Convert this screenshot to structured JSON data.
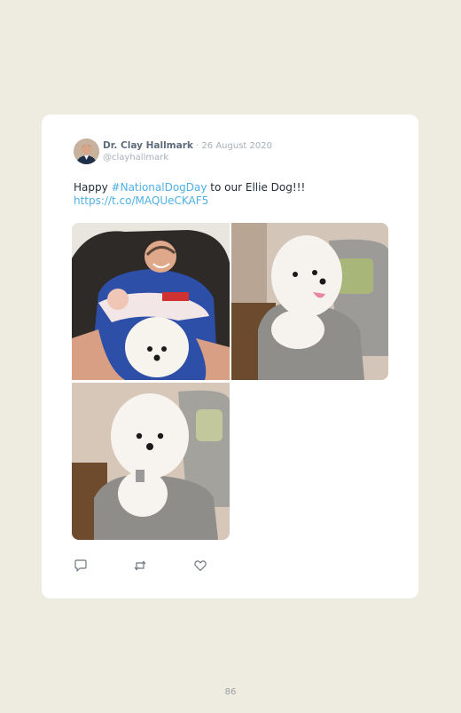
{
  "tweet": {
    "author_name": "Dr. Clay Hallmark",
    "separator": " · ",
    "date": "26 August 2020",
    "handle": "@clayhallmark",
    "text_before": "Happy ",
    "hashtag": "#NationalDogDay",
    "text_after": " to our Ellie Dog!!!",
    "url": "https://t.co/MAQUeCKAF5",
    "photos": [
      "man-holding-baby-and-dog",
      "dog-on-sofa-side",
      "dog-on-sofa-front"
    ],
    "actions": [
      "reply-icon",
      "retweet-icon",
      "like-icon"
    ]
  },
  "colors": {
    "background": "#eeebe1",
    "link": "#4fb0e6",
    "name": "#5d6b7a",
    "muted": "#a7b0b8"
  },
  "page": {
    "number": "86"
  }
}
